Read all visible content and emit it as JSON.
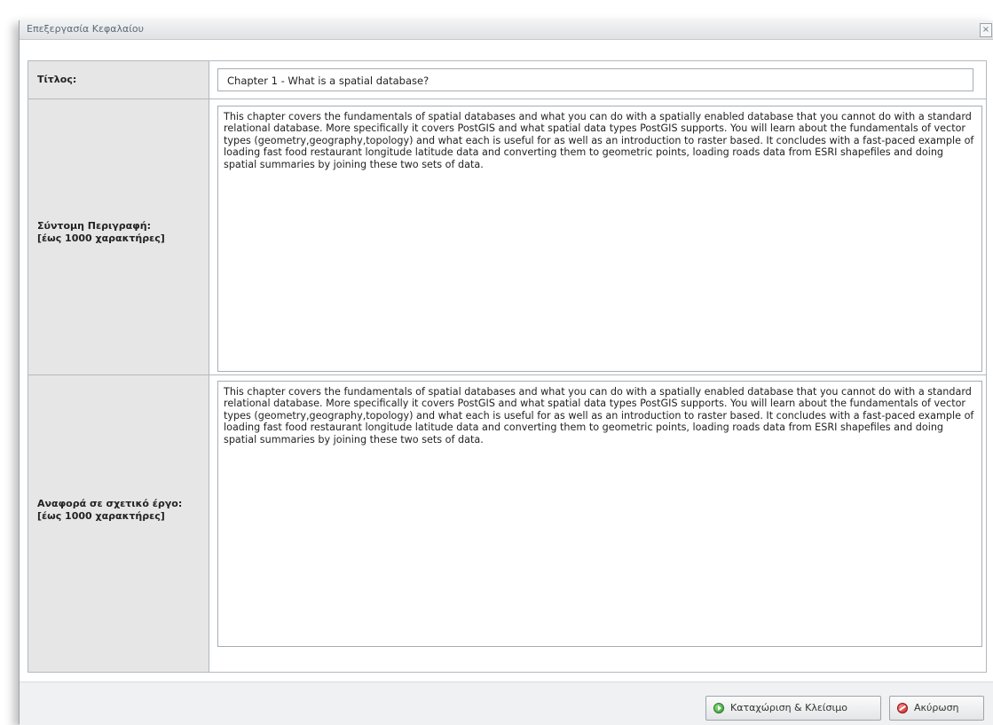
{
  "dialog": {
    "title": "Επεξεργασία Κεφαλαίου",
    "close_label": "×"
  },
  "form": {
    "title_label": "Τίτλος:",
    "title_value": "Chapter 1 - What is a spatial database?",
    "summary_label": "Σύντομη Περιγραφή:\n[έως 1000 χαρακτήρες]",
    "summary_value": "This chapter covers the fundamentals of spatial databases and what you can do with a spatially enabled database that you cannot do with a standard relational database. More specifically it covers PostGIS and what spatial data types PostGIS supports. You will learn about the fundamentals of vector types (geometry,geography,topology) and what each is useful for as well as an introduction to raster based. It concludes with a fast-paced example of loading fast food restaurant longitude latitude data and converting them to geometric points, loading roads data from ESRI shapefiles and doing spatial summaries by joining these two sets of data.",
    "reference_label": "Αναφορά σε σχετικό έργο:\n[έως 1000 χαρακτήρες]",
    "reference_value": "This chapter covers the fundamentals of spatial databases and what you can do with a spatially enabled database that you cannot do with a standard relational database. More specifically it covers PostGIS and what spatial data types PostGIS supports. You will learn about the fundamentals of vector types (geometry,geography,topology) and what each is useful for as well as an introduction to raster based. It concludes with a fast-paced example of loading fast food restaurant longitude latitude data and converting them to geometric points, loading roads data from ESRI shapefiles and doing spatial summaries by joining these two sets of data."
  },
  "footer": {
    "save_label": "Καταχώριση & Κλείσιμο",
    "cancel_label": "Ακύρωση"
  },
  "icons": {
    "save": "save-ok-icon",
    "cancel": "cancel-icon",
    "close": "close-icon"
  }
}
